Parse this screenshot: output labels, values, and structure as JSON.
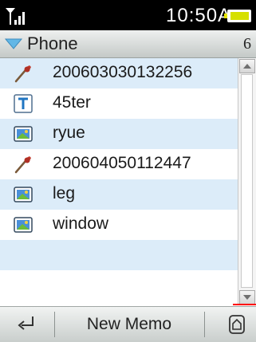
{
  "status": {
    "time": "10:50A",
    "signal_icon": "signal-strength-icon",
    "battery_icon": "battery-icon"
  },
  "header": {
    "title": "Phone",
    "count": "6",
    "icon": "expand-triangle-icon"
  },
  "items": [
    {
      "label": "200603030132256",
      "icon": "voice-memo-icon"
    },
    {
      "label": "45ter",
      "icon": "text-memo-icon"
    },
    {
      "label": "ryue",
      "icon": "image-memo-icon"
    },
    {
      "label": "200604050112447",
      "icon": "voice-memo-icon"
    },
    {
      "label": "leg",
      "icon": "image-memo-icon"
    },
    {
      "label": "window",
      "icon": "image-memo-icon"
    }
  ],
  "softkeys": {
    "left_icon": "back-arrow-icon",
    "center": "New Memo",
    "right_icon": "home-icon"
  },
  "colors": {
    "row_highlight": "#dcecf9",
    "status_bg": "#000000",
    "accent": "#5aaee0",
    "scroll_marker": "#ff0000"
  }
}
